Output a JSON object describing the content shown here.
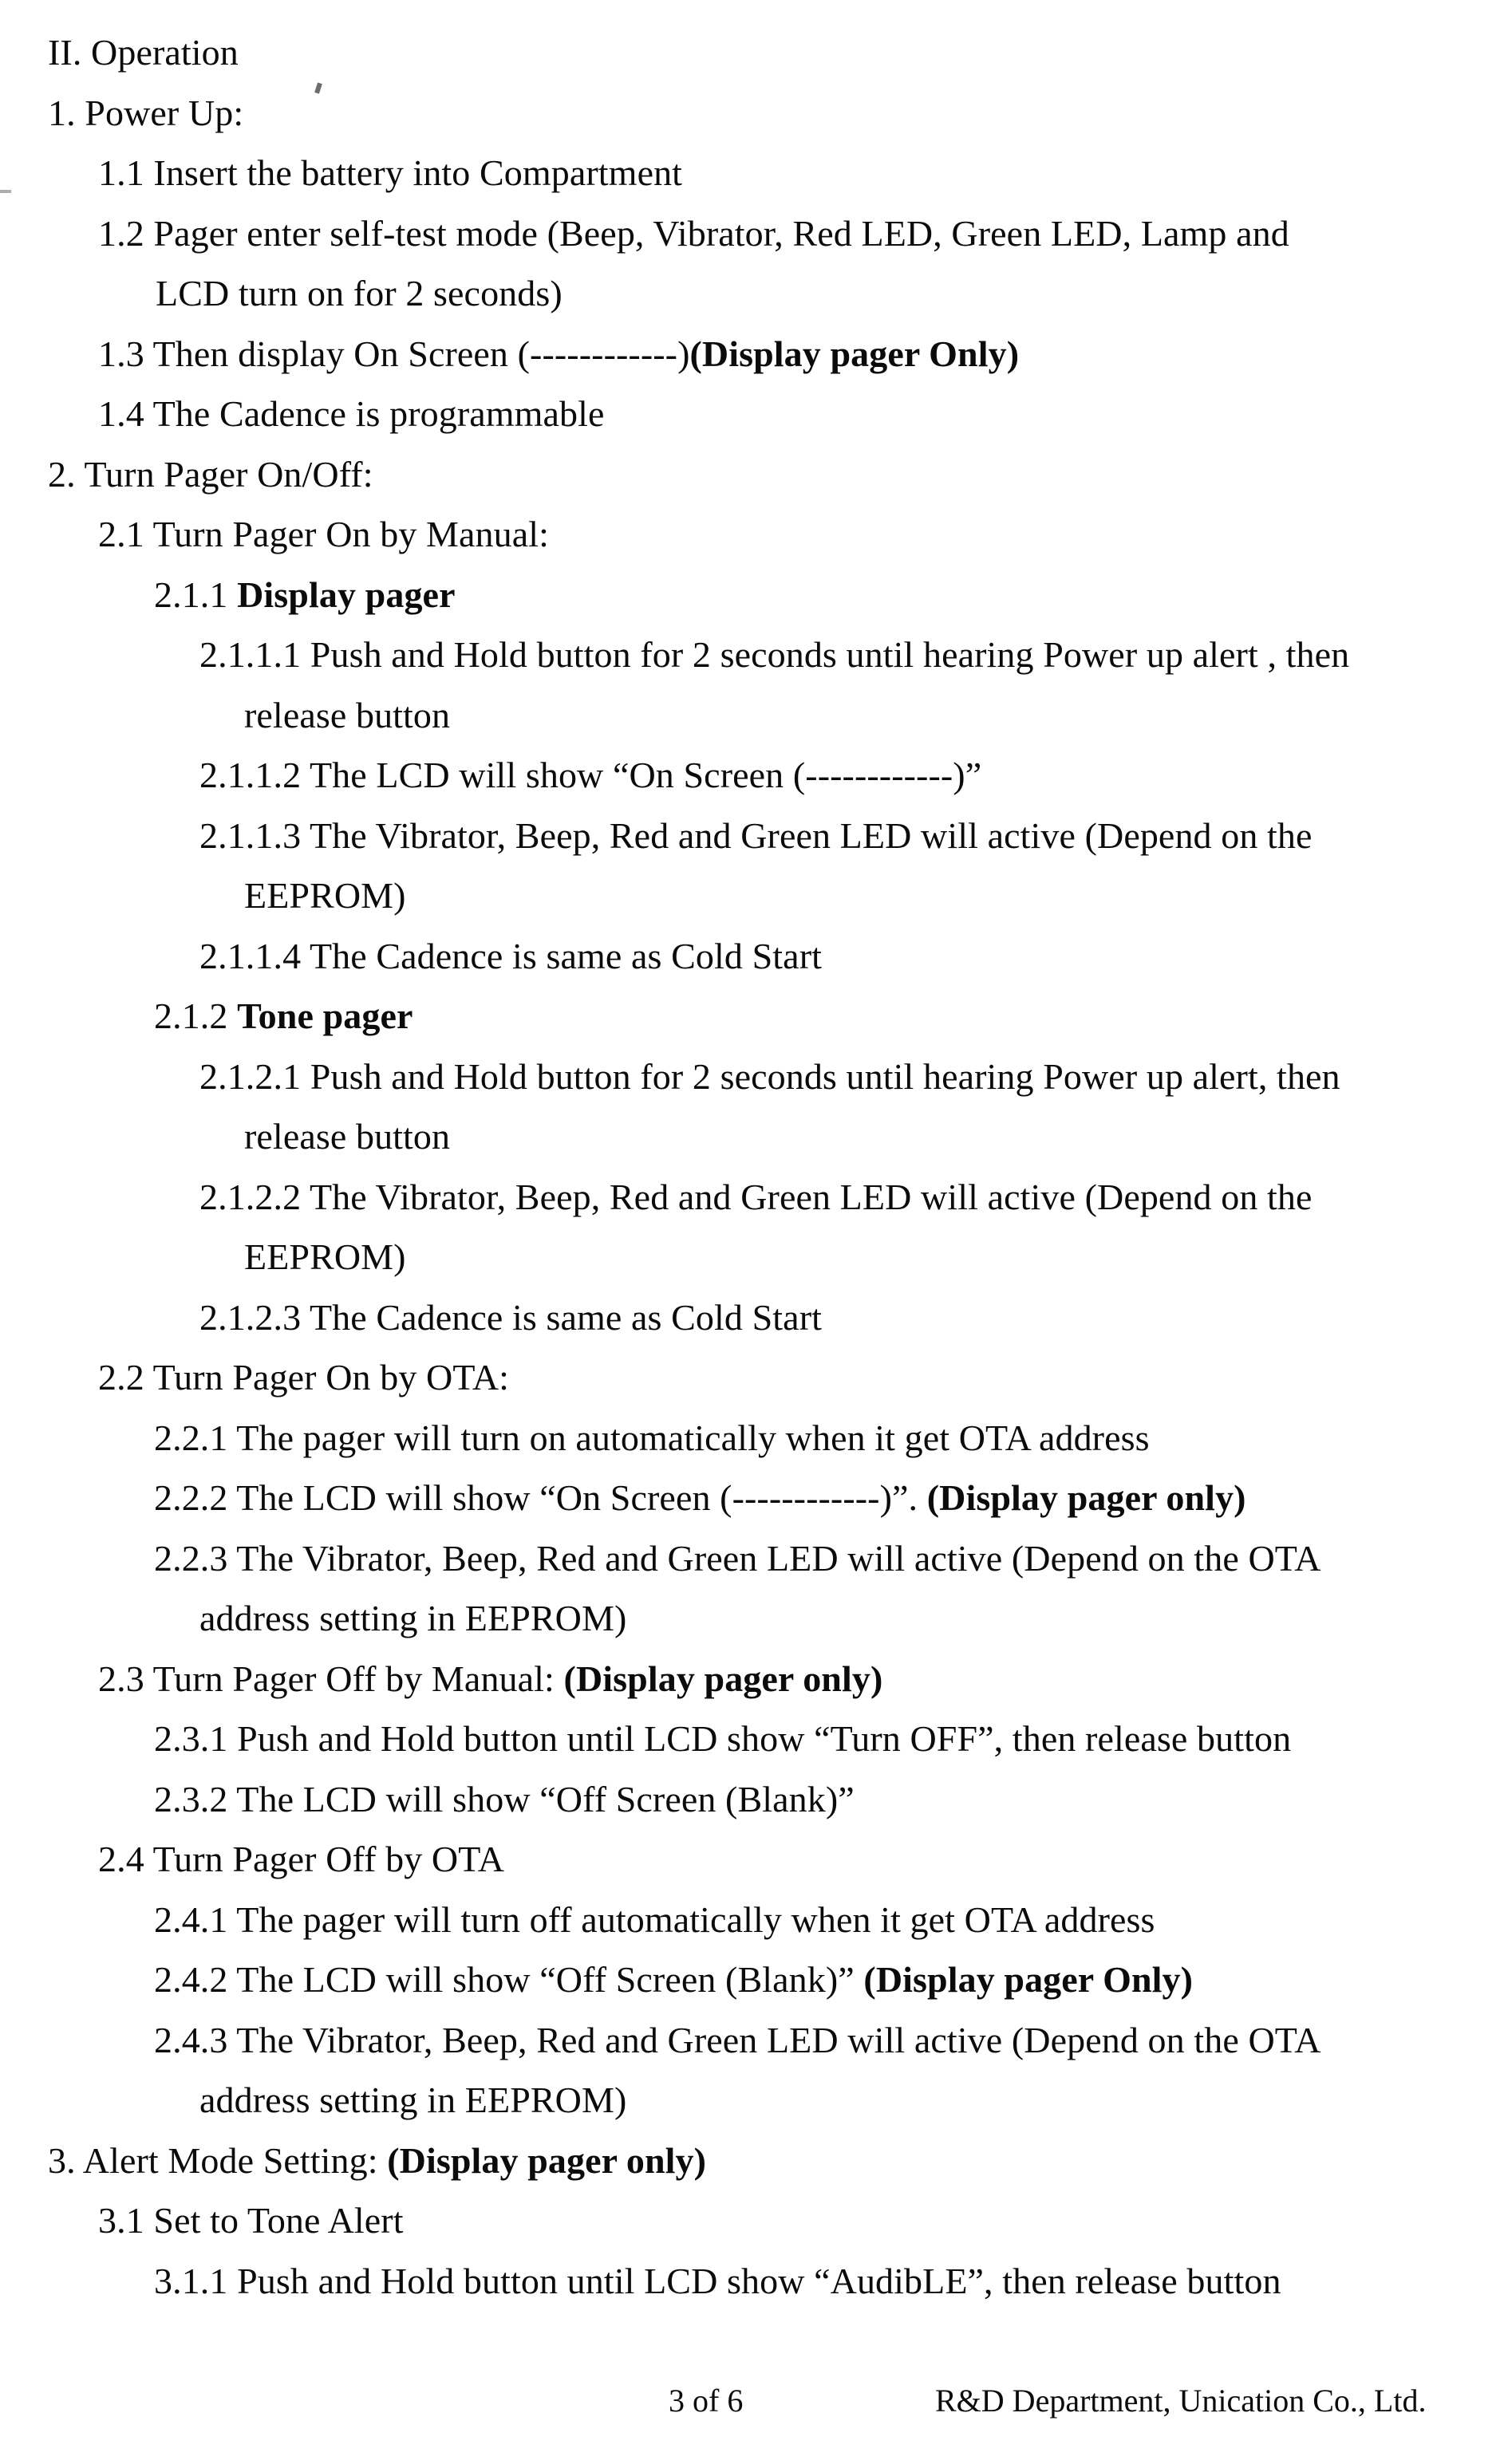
{
  "document": {
    "section_heading": "II. Operation",
    "lines": [
      {
        "id": "heading",
        "indent": "lv0",
        "segments": [
          {
            "text": "II. Operation",
            "bold": false
          }
        ]
      },
      {
        "id": "l-1",
        "indent": "lv0",
        "segments": [
          {
            "text": "1. Power Up:",
            "bold": false
          }
        ]
      },
      {
        "id": "l-1-1",
        "indent": "lv1",
        "segments": [
          {
            "text": "1.1 Insert the battery into Compartment",
            "bold": false
          }
        ]
      },
      {
        "id": "l-1-2",
        "indent": "lv1",
        "segments": [
          {
            "text": "1.2 Pager enter self-test mode (Beep, Vibrator, Red LED, Green LED, Lamp and",
            "bold": false
          }
        ]
      },
      {
        "id": "l-1-2w",
        "indent": "lv1w",
        "segments": [
          {
            "text": "LCD turn on for 2 seconds)",
            "bold": false
          }
        ]
      },
      {
        "id": "l-1-3",
        "indent": "lv1",
        "segments": [
          {
            "text": "1.3 Then display On Screen (------------)",
            "bold": false
          },
          {
            "text": "(Display pager Only)",
            "bold": true
          }
        ]
      },
      {
        "id": "l-1-4",
        "indent": "lv1",
        "segments": [
          {
            "text": "1.4 The Cadence is programmable",
            "bold": false
          }
        ]
      },
      {
        "id": "l-2",
        "indent": "lv0",
        "segments": [
          {
            "text": "2. Turn Pager On/Off:",
            "bold": false
          }
        ]
      },
      {
        "id": "l-2-1",
        "indent": "lv1",
        "segments": [
          {
            "text": "2.1 Turn Pager On by Manual:",
            "bold": false
          }
        ]
      },
      {
        "id": "l-2-1-1",
        "indent": "lv2",
        "segments": [
          {
            "text": "2.1.1  ",
            "bold": false
          },
          {
            "text": "Display pager",
            "bold": true
          }
        ]
      },
      {
        "id": "l-2-1-1-1",
        "indent": "lv3",
        "segments": [
          {
            "text": "2.1.1.1 Push and Hold button for 2 seconds until hearing Power up alert , then",
            "bold": false
          }
        ]
      },
      {
        "id": "l-2-1-1-1w",
        "indent": "lv3w",
        "segments": [
          {
            "text": "release button",
            "bold": false
          }
        ]
      },
      {
        "id": "l-2-1-1-2",
        "indent": "lv3",
        "segments": [
          {
            "text": "2.1.1.2 The LCD will show “On Screen (------------)”",
            "bold": false
          }
        ]
      },
      {
        "id": "l-2-1-1-3",
        "indent": "lv3",
        "segments": [
          {
            "text": "2.1.1.3 The Vibrator, Beep, Red and Green LED will active (Depend on the",
            "bold": false
          }
        ]
      },
      {
        "id": "l-2-1-1-3w",
        "indent": "lv3w",
        "segments": [
          {
            "text": "EEPROM)",
            "bold": false
          }
        ]
      },
      {
        "id": "l-2-1-1-4",
        "indent": "lv3",
        "segments": [
          {
            "text": "2.1.1.4 The Cadence is same as Cold Start",
            "bold": false
          }
        ]
      },
      {
        "id": "l-2-1-2",
        "indent": "lv2",
        "segments": [
          {
            "text": "2.1.2  ",
            "bold": false
          },
          {
            "text": "Tone pager",
            "bold": true
          }
        ]
      },
      {
        "id": "l-2-1-2-1",
        "indent": "lv3",
        "segments": [
          {
            "text": "2.1.2.1 Push and Hold button for 2 seconds until hearing Power up alert, then",
            "bold": false
          }
        ]
      },
      {
        "id": "l-2-1-2-1w",
        "indent": "lv3w",
        "segments": [
          {
            "text": "release button",
            "bold": false
          }
        ]
      },
      {
        "id": "l-2-1-2-2",
        "indent": "lv3",
        "segments": [
          {
            "text": "2.1.2.2 The Vibrator, Beep, Red and Green LED will active (Depend on the",
            "bold": false
          }
        ]
      },
      {
        "id": "l-2-1-2-2w",
        "indent": "lv3w",
        "segments": [
          {
            "text": "EEPROM)",
            "bold": false
          }
        ]
      },
      {
        "id": "l-2-1-2-3",
        "indent": "lv3",
        "segments": [
          {
            "text": "2.1.2.3 The Cadence is same as Cold Start",
            "bold": false
          }
        ]
      },
      {
        "id": "l-2-2",
        "indent": "lv1",
        "segments": [
          {
            "text": "2.2 Turn Pager On by OTA:",
            "bold": false
          }
        ]
      },
      {
        "id": "l-2-2-1",
        "indent": "lv2",
        "segments": [
          {
            "text": "2.2.1  The pager will turn on automatically when it get OTA address",
            "bold": false
          }
        ]
      },
      {
        "id": "l-2-2-2",
        "indent": "lv2",
        "segments": [
          {
            "text": "2.2.2  The LCD will show “On Screen (------------)”. ",
            "bold": false
          },
          {
            "text": "(Display pager only)",
            "bold": true
          }
        ]
      },
      {
        "id": "l-2-2-3",
        "indent": "lv2",
        "segments": [
          {
            "text": "2.2.3  The Vibrator, Beep, Red and Green LED will active (Depend on the OTA",
            "bold": false
          }
        ]
      },
      {
        "id": "l-2-2-3w",
        "indent": "lv2w",
        "segments": [
          {
            "text": "address setting in EEPROM)",
            "bold": false
          }
        ]
      },
      {
        "id": "l-2-3",
        "indent": "lv1",
        "segments": [
          {
            "text": "2.3 Turn Pager Off by Manual: ",
            "bold": false
          },
          {
            "text": "(Display pager only)",
            "bold": true
          }
        ]
      },
      {
        "id": "l-2-3-1",
        "indent": "lv2",
        "segments": [
          {
            "text": "2.3.1  Push and Hold button until LCD show “Turn OFF”, then release button",
            "bold": false
          }
        ]
      },
      {
        "id": "l-2-3-2",
        "indent": "lv2",
        "segments": [
          {
            "text": "2.3.2  The LCD will show “Off Screen (Blank)”",
            "bold": false
          }
        ]
      },
      {
        "id": "l-2-4",
        "indent": "lv1",
        "segments": [
          {
            "text": "2.4 Turn Pager Off by OTA",
            "bold": false
          }
        ]
      },
      {
        "id": "l-2-4-1",
        "indent": "lv2",
        "segments": [
          {
            "text": "2.4.1  The pager will turn off automatically when it get OTA address",
            "bold": false
          }
        ]
      },
      {
        "id": "l-2-4-2",
        "indent": "lv2",
        "segments": [
          {
            "text": "2.4.2  The LCD will show “Off Screen (Blank)” ",
            "bold": false
          },
          {
            "text": "(Display pager Only)",
            "bold": true
          }
        ]
      },
      {
        "id": "l-2-4-3",
        "indent": "lv2",
        "segments": [
          {
            "text": "2.4.3  The Vibrator, Beep, Red and Green LED will active (Depend on the OTA",
            "bold": false
          }
        ]
      },
      {
        "id": "l-2-4-3w",
        "indent": "lv2w",
        "segments": [
          {
            "text": "address setting in EEPROM)",
            "bold": false
          }
        ]
      },
      {
        "id": "l-3",
        "indent": "lv0",
        "segments": [
          {
            "text": "3. Alert Mode Setting: ",
            "bold": false
          },
          {
            "text": "(Display pager only)",
            "bold": true
          }
        ]
      },
      {
        "id": "l-3-1",
        "indent": "lv1",
        "segments": [
          {
            "text": "3.1 Set to Tone Alert",
            "bold": false
          }
        ]
      },
      {
        "id": "l-3-1-1",
        "indent": "lv2",
        "segments": [
          {
            "text": "3.1.1  Push and Hold button until LCD show “AudibLE”, then release button",
            "bold": false
          }
        ]
      }
    ]
  },
  "footer": {
    "page_number": "3 of 6",
    "department": "R&D Department, Unication Co., Ltd."
  },
  "colors": {
    "page_background": "#ffffff",
    "text": "#0b0b0b"
  }
}
